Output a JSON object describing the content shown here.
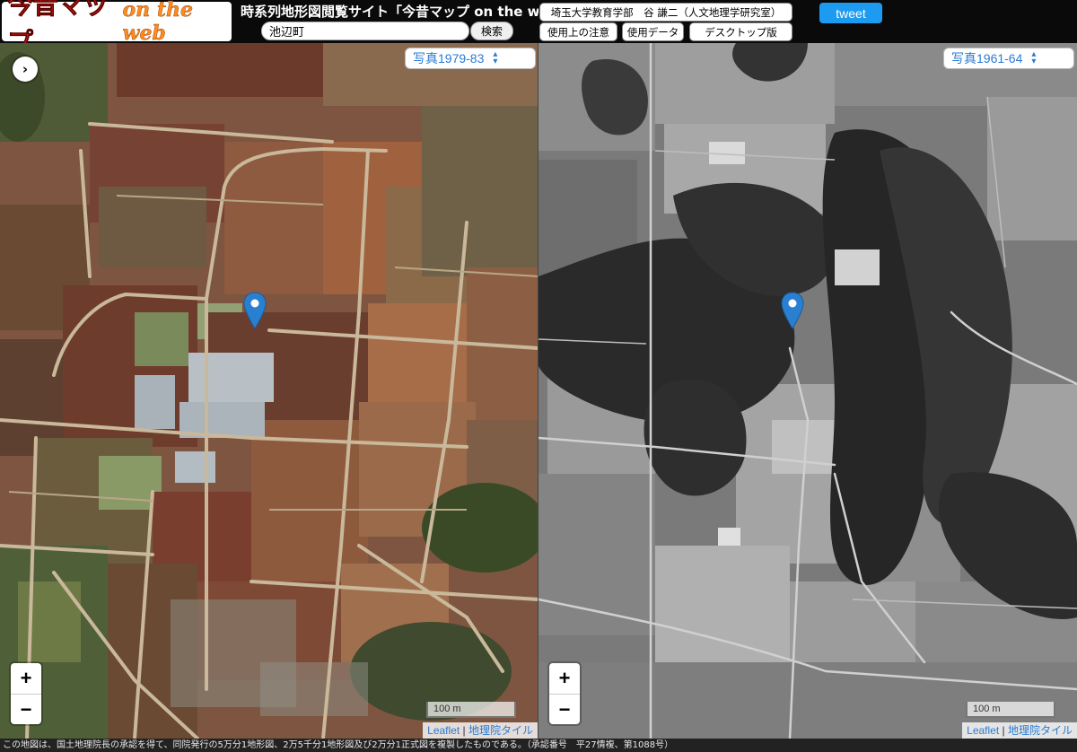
{
  "header": {
    "logo_main": "今昔マップ",
    "logo_sub": "on the web",
    "site_title": "時系列地形図閲覧サイト「今昔マップ on the web」",
    "search": {
      "value": "池辺町",
      "button_label": "検索"
    },
    "affiliation": "埼玉大学教育学部　谷 謙二（人文地理学研究室）",
    "buttons": {
      "usage_notes": "使用上の注意",
      "data_used": "使用データ",
      "desktop": "デスクトップ版"
    },
    "tweet_label": "tweet"
  },
  "maps": {
    "left": {
      "era": "写真1979-83",
      "scale_label": "100 m",
      "attribution_link1": "Leaflet",
      "attribution_sep": " | ",
      "attribution_link2": "地理院タイル"
    },
    "right": {
      "era": "写真1961-64",
      "scale_label": "100 m",
      "attribution_link1": "Leaflet",
      "attribution_sep": " | ",
      "attribution_link2": "地理院タイル"
    },
    "controls": {
      "sidebar_toggle": "›",
      "zoom_in": "+",
      "zoom_out": "−"
    }
  },
  "footer": {
    "text": "この地図は、国土地理院長の承認を得て、同院発行の5万分1地形図、2万5千分1地形図及び2万分1正式図を複製したものである。（承認番号　平27情複、第1088号）"
  },
  "colors": {
    "accent": "#2a7bd4",
    "tweet": "#1d9bf0",
    "marker": "#2a80d0"
  },
  "icons": {
    "marker": "map-marker-icon",
    "select": "chevron-up-down-icon",
    "toggle": "chevron-right-icon"
  }
}
